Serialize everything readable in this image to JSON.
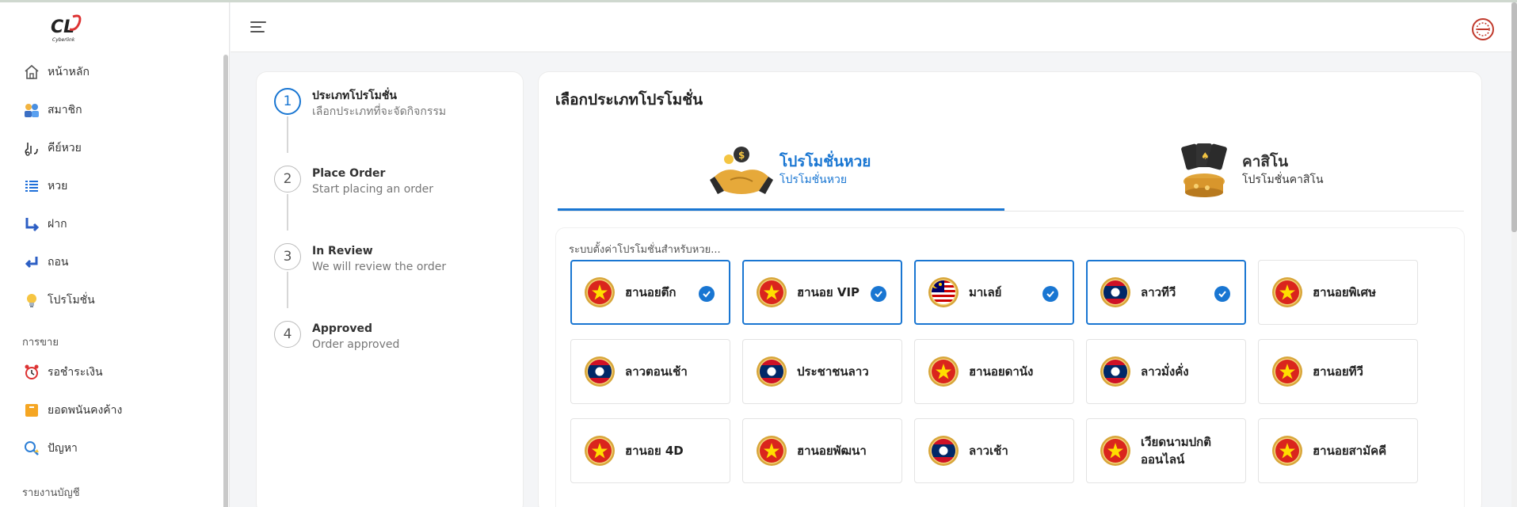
{
  "app": {
    "logo_text": "Cyberlink"
  },
  "sidebar": {
    "items": [
      {
        "label": "หน้าหลัก",
        "icon": "home-icon"
      },
      {
        "label": "สมาชิก",
        "icon": "members-icon"
      },
      {
        "label": "คีย์หวย",
        "icon": "key-lotto-icon"
      },
      {
        "label": "หวย",
        "icon": "list-icon"
      },
      {
        "label": "ฝาก",
        "icon": "deposit-arrow-icon"
      },
      {
        "label": "ถอน",
        "icon": "withdraw-arrow-icon"
      },
      {
        "label": "โปรโมชั่น",
        "icon": "lightbulb-icon"
      }
    ],
    "section_sales": "การขาย",
    "sales_items": [
      {
        "label": "รอชำระเงิน",
        "icon": "alarm-clock-icon"
      },
      {
        "label": "ยอดพนันคงค้าง",
        "icon": "box-icon"
      },
      {
        "label": "ปัญหา",
        "icon": "problem-icon"
      }
    ],
    "section_reports": "รายงานบัญชี"
  },
  "steps": [
    {
      "num": "1",
      "title": "ประเภทโปรโมชั่น",
      "subtitle": "เลือกประเภทที่จะจัดกิจกรรม",
      "active": true
    },
    {
      "num": "2",
      "title": "Place Order",
      "subtitle": "Start placing an order",
      "active": false
    },
    {
      "num": "3",
      "title": "In Review",
      "subtitle": "We will review the order",
      "active": false
    },
    {
      "num": "4",
      "title": "Approved",
      "subtitle": "Order approved",
      "active": false
    }
  ],
  "main": {
    "title": "เลือกประเภทโปรโมชั่น",
    "tabs": [
      {
        "title": "โปรโมชั่นหวย",
        "subtitle": "โปรโมชั่นหวย",
        "active": true
      },
      {
        "title": "คาสิโน",
        "subtitle": "โปรโมชั่นคาสิโน",
        "active": false
      }
    ],
    "panel_label": "ระบบตั้งค่าโปรโมชั่นสำหรับหวย...",
    "lotteries": [
      {
        "name": "ฮานอยตึก",
        "flag": "vietnam",
        "selected": true
      },
      {
        "name": "ฮานอย VIP",
        "flag": "vietnam",
        "selected": true
      },
      {
        "name": "มาเลย์",
        "flag": "malaysia",
        "selected": true
      },
      {
        "name": "ลาวทีวี",
        "flag": "laos",
        "selected": true
      },
      {
        "name": "ฮานอยพิเศษ",
        "flag": "vietnam",
        "selected": false
      },
      {
        "name": "ลาวตอนเช้า",
        "flag": "laos",
        "selected": false
      },
      {
        "name": "ประชาชนลาว",
        "flag": "laos",
        "selected": false
      },
      {
        "name": "ฮานอยดานัง",
        "flag": "vietnam",
        "selected": false
      },
      {
        "name": "ลาวมั่งคั่ง",
        "flag": "laos",
        "selected": false
      },
      {
        "name": "ฮานอยทีวี",
        "flag": "vietnam",
        "selected": false
      },
      {
        "name": "ฮานอย 4D",
        "flag": "vietnam",
        "selected": false
      },
      {
        "name": "ฮานอยพัฒนา",
        "flag": "vietnam",
        "selected": false
      },
      {
        "name": "ลาวเช้า",
        "flag": "laos",
        "selected": false
      },
      {
        "name": "เวียดนามปกติ\nออนไลน์",
        "flag": "vietnam",
        "selected": false
      },
      {
        "name": "ฮานอยสามัคคี",
        "flag": "vietnam",
        "selected": false
      }
    ]
  },
  "colors": {
    "accent": "#1976d2",
    "vietnam_red": "#da251d",
    "laos_blue": "#002868",
    "laos_red": "#ce1126",
    "gold_ring": "#d8a63a"
  }
}
